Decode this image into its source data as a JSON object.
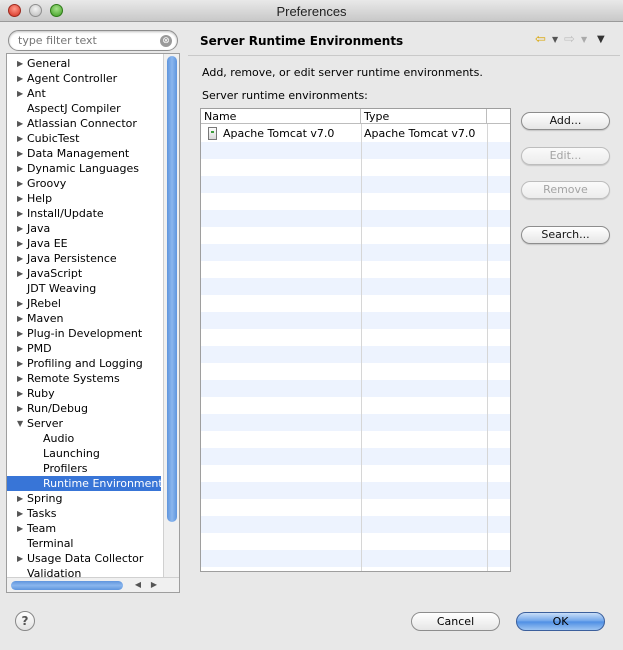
{
  "window": {
    "title": "Preferences"
  },
  "filter": {
    "placeholder": "type filter text",
    "clear_glyph": "⊗"
  },
  "tree": {
    "items": [
      {
        "label": "General",
        "expandable": true,
        "indent": 0
      },
      {
        "label": "Agent Controller",
        "expandable": true,
        "indent": 0
      },
      {
        "label": "Ant",
        "expandable": true,
        "indent": 0
      },
      {
        "label": "AspectJ Compiler",
        "expandable": false,
        "indent": 0
      },
      {
        "label": "Atlassian Connector",
        "expandable": true,
        "indent": 0
      },
      {
        "label": "CubicTest",
        "expandable": true,
        "indent": 0
      },
      {
        "label": "Data Management",
        "expandable": true,
        "indent": 0
      },
      {
        "label": "Dynamic Languages",
        "expandable": true,
        "indent": 0
      },
      {
        "label": "Groovy",
        "expandable": true,
        "indent": 0
      },
      {
        "label": "Help",
        "expandable": true,
        "indent": 0
      },
      {
        "label": "Install/Update",
        "expandable": true,
        "indent": 0
      },
      {
        "label": "Java",
        "expandable": true,
        "indent": 0
      },
      {
        "label": "Java EE",
        "expandable": true,
        "indent": 0
      },
      {
        "label": "Java Persistence",
        "expandable": true,
        "indent": 0
      },
      {
        "label": "JavaScript",
        "expandable": true,
        "indent": 0
      },
      {
        "label": "JDT Weaving",
        "expandable": false,
        "indent": 0
      },
      {
        "label": "JRebel",
        "expandable": true,
        "indent": 0
      },
      {
        "label": "Maven",
        "expandable": true,
        "indent": 0
      },
      {
        "label": "Plug-in Development",
        "expandable": true,
        "indent": 0
      },
      {
        "label": "PMD",
        "expandable": true,
        "indent": 0
      },
      {
        "label": "Profiling and Logging",
        "expandable": true,
        "indent": 0
      },
      {
        "label": "Remote Systems",
        "expandable": true,
        "indent": 0
      },
      {
        "label": "Ruby",
        "expandable": true,
        "indent": 0
      },
      {
        "label": "Run/Debug",
        "expandable": true,
        "indent": 0
      },
      {
        "label": "Server",
        "expandable": true,
        "expanded": true,
        "indent": 0
      },
      {
        "label": "Audio",
        "expandable": false,
        "indent": 1
      },
      {
        "label": "Launching",
        "expandable": false,
        "indent": 1
      },
      {
        "label": "Profilers",
        "expandable": false,
        "indent": 1
      },
      {
        "label": "Runtime Environments",
        "expandable": false,
        "indent": 1,
        "selected": true
      },
      {
        "label": "Spring",
        "expandable": true,
        "indent": 0
      },
      {
        "label": "Tasks",
        "expandable": true,
        "indent": 0
      },
      {
        "label": "Team",
        "expandable": true,
        "indent": 0
      },
      {
        "label": "Terminal",
        "expandable": false,
        "indent": 0
      },
      {
        "label": "Usage Data Collector",
        "expandable": true,
        "indent": 0
      },
      {
        "label": "Validation",
        "expandable": false,
        "indent": 0
      }
    ]
  },
  "page": {
    "title": "Server Runtime Environments",
    "description": "Add, remove, or edit server runtime environments.",
    "table_label": "Server runtime environments:",
    "columns": [
      "Name",
      "Type"
    ],
    "rows": [
      {
        "name": "Apache Tomcat v7.0",
        "type": "Apache Tomcat v7.0",
        "icon": "server-icon"
      }
    ],
    "buttons": {
      "add": "Add...",
      "edit": "Edit...",
      "remove": "Remove",
      "search": "Search..."
    }
  },
  "footer": {
    "help": "?",
    "cancel": "Cancel",
    "ok": "OK"
  },
  "colors": {
    "selection": "#3875d7",
    "row_alt": "#edf3fe",
    "ok_button": "#4d8ee4"
  }
}
